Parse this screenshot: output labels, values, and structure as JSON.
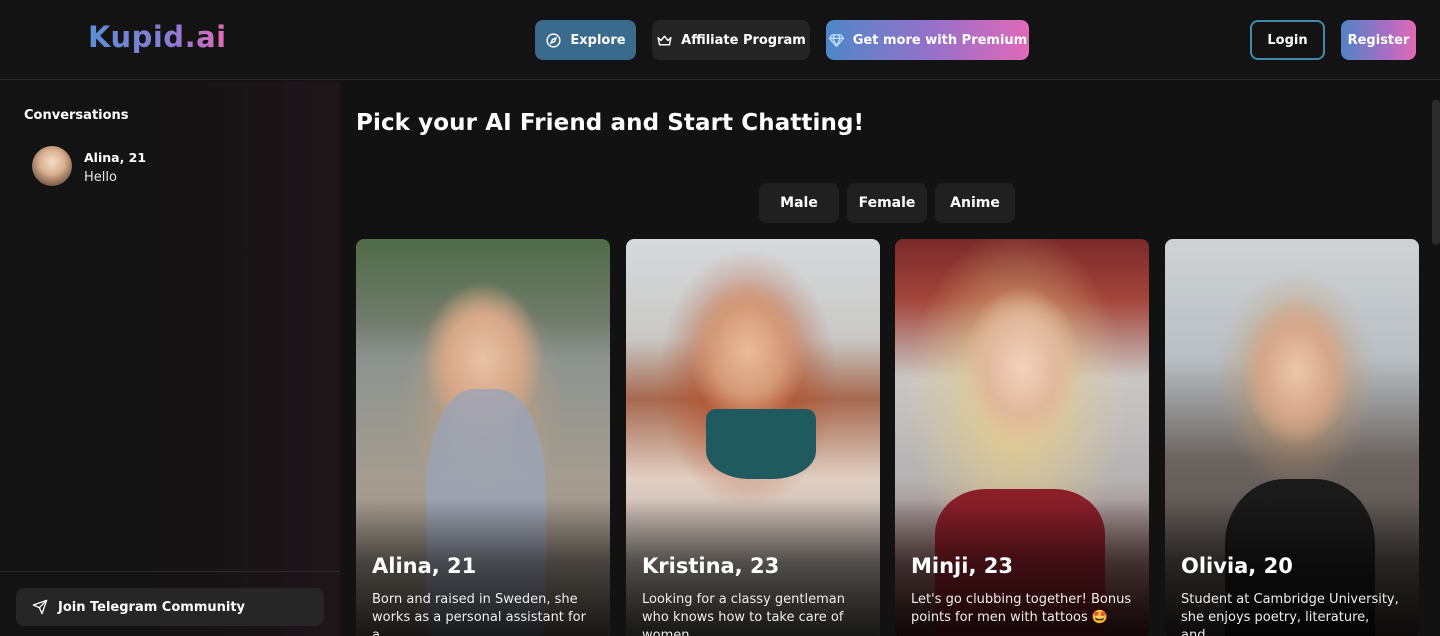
{
  "app": {
    "logo": "Kupid.ai"
  },
  "header": {
    "explore_label": "Explore",
    "affiliate_label": "Affiliate Program",
    "premium_label": "Get more with Premium",
    "login_label": "Login",
    "register_label": "Register"
  },
  "sidebar": {
    "title": "Conversations",
    "conversations": [
      {
        "name": "Alina, 21",
        "last_message": "Hello"
      }
    ],
    "telegram_label": "Join Telegram Community"
  },
  "main": {
    "title": "Pick your AI Friend and Start Chatting!",
    "filters": [
      "Male",
      "Female",
      "Anime"
    ],
    "cards": [
      {
        "name": "Alina, 21",
        "description": "Born and raised in Sweden, she works as a personal assistant for a..."
      },
      {
        "name": "Kristina, 23",
        "description": "Looking for a classy gentleman who knows how to take care of women."
      },
      {
        "name": "Minji, 23",
        "description": "Let's go clubbing together! Bonus points for men with tattoos 🤩"
      },
      {
        "name": "Olivia, 20",
        "description": "Student at Cambridge University, she enjoys poetry, literature, and..."
      }
    ]
  },
  "colors": {
    "background": "#121212",
    "explore_button": "#3a6a8c",
    "login_border": "#3e8aaa",
    "brand_gradient_start": "#5b8fd6",
    "brand_gradient_end": "#e46ab6"
  },
  "icons": [
    "compass-icon",
    "crown-icon",
    "diamond-icon",
    "send-icon"
  ]
}
